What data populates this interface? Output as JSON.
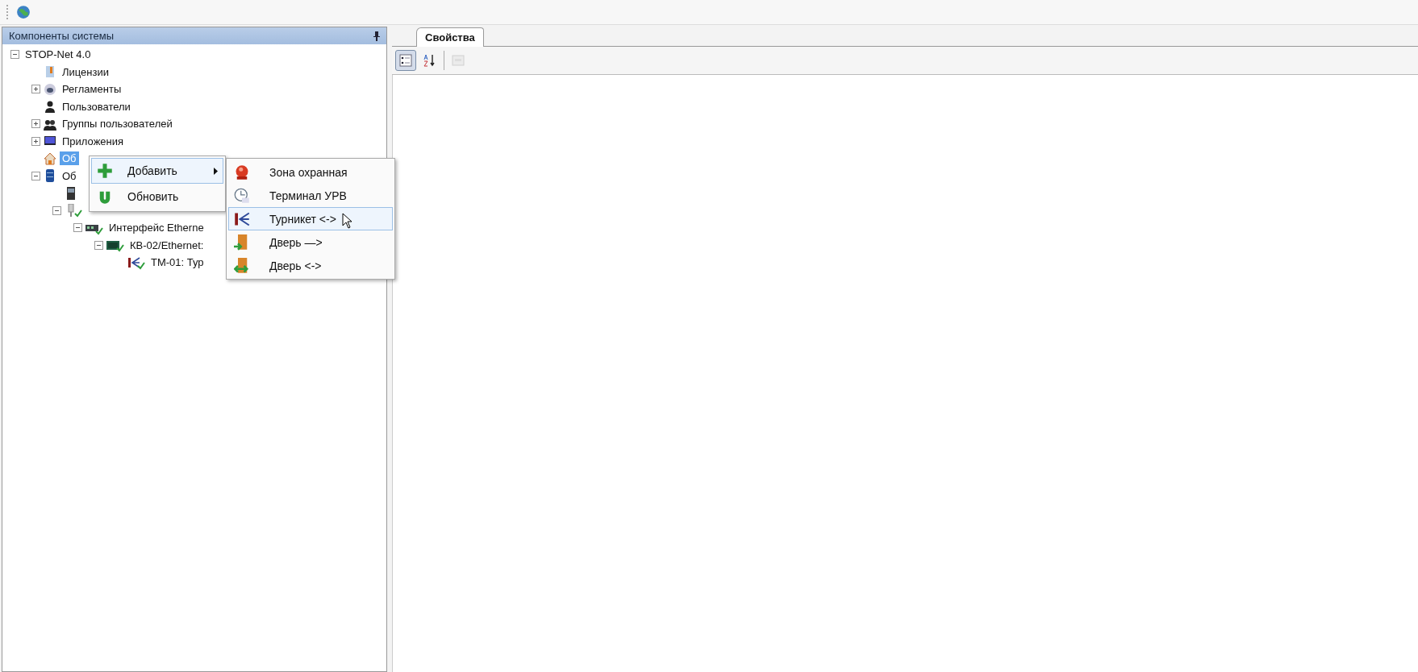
{
  "toolbar": {
    "buttons": [
      {
        "kind": "globe"
      }
    ]
  },
  "left_panel": {
    "title": "Компоненты системы",
    "tree": [
      {
        "label": "STOP-Net 4.0",
        "expanded": true,
        "selected": false,
        "children": [
          {
            "label": "Лицензии",
            "kind": "license",
            "selected": false
          },
          {
            "label": "Регламенты",
            "kind": "schedule",
            "expanded": false,
            "selected": false
          },
          {
            "label": "Пользователи",
            "kind": "user",
            "selected": false
          },
          {
            "label": "Группы пользователей",
            "kind": "group",
            "expanded": false,
            "selected": false
          },
          {
            "label": "Приложения",
            "kind": "app",
            "expanded": false,
            "selected": false
          },
          {
            "label": "Об",
            "kind": "home",
            "selected": true
          },
          {
            "label": "Об",
            "kind": "server",
            "expanded": true,
            "selected": false,
            "children": [
              {
                "kind": "rack"
              },
              {
                "kind": "device",
                "expanded": true,
                "online": true,
                "children": [
                  {
                    "label": "Интерфейс Etherne",
                    "kind": "ethernet",
                    "expanded": true,
                    "online": true,
                    "selected": false,
                    "children": [
                      {
                        "label": "КВ-02/Ethernet:",
                        "kind": "controller",
                        "expanded": true,
                        "online": true,
                        "selected": false,
                        "children": [
                          {
                            "label": "ТМ-01: Тур",
                            "kind": "turnstile",
                            "online": true,
                            "selected": false
                          }
                        ]
                      }
                    ]
                  }
                ]
              }
            ]
          }
        ]
      }
    ]
  },
  "context_menu": {
    "items": [
      {
        "label": "Добавить",
        "kind": "add",
        "submenu": true,
        "selected": true
      },
      {
        "label": "Обновить",
        "kind": "refresh",
        "submenu": false,
        "selected": false
      }
    ]
  },
  "submenu": {
    "items": [
      {
        "label": "Зона охранная",
        "kind": "alarm",
        "selected": false
      },
      {
        "label": "Терминал УРВ",
        "kind": "terminal",
        "selected": false
      },
      {
        "label": "Турникет <->",
        "kind": "turnstile",
        "selected": true
      },
      {
        "label": "Дверь —>",
        "kind": "door",
        "selected": false
      },
      {
        "label": "Дверь <->",
        "kind": "door2",
        "selected": false
      }
    ]
  },
  "right_panel": {
    "tabs": [
      {
        "label": "Свойства",
        "selected": true
      }
    ],
    "toolbar": [
      {
        "kind": "categorized",
        "selected": true,
        "disabled": false
      },
      {
        "kind": "alphabetical",
        "selected": false,
        "disabled": false
      },
      {
        "kind": "pages",
        "selected": false,
        "disabled": true
      }
    ]
  }
}
